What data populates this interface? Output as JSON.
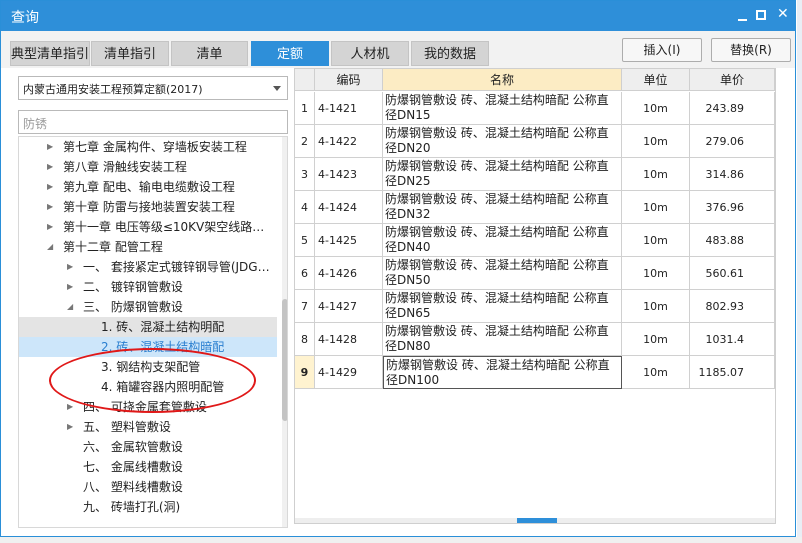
{
  "window": {
    "title": "查询"
  },
  "tabs": [
    "典型清单指引",
    "清单指引",
    "清单",
    "定额",
    "人材机",
    "我的数据"
  ],
  "active_tab": 3,
  "actions": {
    "insert": "插入(I)",
    "replace": "替换(R)"
  },
  "left": {
    "dropdown_value": "内蒙古通用安装工程预算定额(2017)",
    "search_value": "防锈",
    "tree": [
      {
        "label": "第七章 金属构件、穿墙板安装工程",
        "arrow": "▶"
      },
      {
        "label": "第八章 滑触线安装工程",
        "arrow": "▶"
      },
      {
        "label": "第九章 配电、输电电缆敷设工程",
        "arrow": "▶"
      },
      {
        "label": "第十章 防雷与接地装置安装工程",
        "arrow": "▶"
      },
      {
        "label": "第十一章 电压等级≤10KV架空线路…",
        "arrow": "▶"
      },
      {
        "label": "第十二章 配管工程",
        "arrow": "◢"
      },
      {
        "label": "一、 套接紧定式镀锌钢导管(JDG…",
        "arrow": "▶"
      },
      {
        "label": "二、 镀锌钢管敷设",
        "arrow": "▶"
      },
      {
        "label": "三、 防爆钢管敷设",
        "arrow": "◢"
      },
      {
        "label": "1. 砖、混凝土结构明配",
        "arrow": ""
      },
      {
        "label": "2. 砖、混凝土结构暗配",
        "arrow": ""
      },
      {
        "label": "3. 钢结构支架配管",
        "arrow": ""
      },
      {
        "label": "4. 箱罐容器内照明配管",
        "arrow": ""
      },
      {
        "label": "四、 可挠金属套管敷设",
        "arrow": "▶"
      },
      {
        "label": "五、 塑料管敷设",
        "arrow": "▶"
      },
      {
        "label": "六、 金属软管敷设",
        "arrow": ""
      },
      {
        "label": "七、 金属线槽敷设",
        "arrow": ""
      },
      {
        "label": "八、 塑料线槽敷设",
        "arrow": ""
      },
      {
        "label": "九、 砖墙打孔(洞)",
        "arrow": ""
      }
    ]
  },
  "grid": {
    "headers": [
      "编码",
      "名称",
      "单位",
      "单价"
    ],
    "rows": [
      {
        "idx": "1",
        "code": "4-1421",
        "name": "防爆钢管敷设 砖、混凝土结构暗配 公称直径DN15",
        "unit": "10m",
        "price": "243.89"
      },
      {
        "idx": "2",
        "code": "4-1422",
        "name": "防爆钢管敷设 砖、混凝土结构暗配 公称直径DN20",
        "unit": "10m",
        "price": "279.06"
      },
      {
        "idx": "3",
        "code": "4-1423",
        "name": "防爆钢管敷设 砖、混凝土结构暗配 公称直径DN25",
        "unit": "10m",
        "price": "314.86"
      },
      {
        "idx": "4",
        "code": "4-1424",
        "name": "防爆钢管敷设 砖、混凝土结构暗配 公称直径DN32",
        "unit": "10m",
        "price": "376.96"
      },
      {
        "idx": "5",
        "code": "4-1425",
        "name": "防爆钢管敷设 砖、混凝土结构暗配 公称直径DN40",
        "unit": "10m",
        "price": "483.88"
      },
      {
        "idx": "6",
        "code": "4-1426",
        "name": "防爆钢管敷设 砖、混凝土结构暗配 公称直径DN50",
        "unit": "10m",
        "price": "560.61"
      },
      {
        "idx": "7",
        "code": "4-1427",
        "name": "防爆钢管敷设 砖、混凝土结构暗配 公称直径DN65",
        "unit": "10m",
        "price": "802.93"
      },
      {
        "idx": "8",
        "code": "4-1428",
        "name": "防爆钢管敷设 砖、混凝土结构暗配 公称直径DN80",
        "unit": "10m",
        "price": "1031.4"
      },
      {
        "idx": "9",
        "code": "4-1429",
        "name": "防爆钢管敷设 砖、混凝土结构暗配 公称直径DN100",
        "unit": "10m",
        "price": "1185.07"
      }
    ]
  },
  "colors": {
    "accent": "#2e8fd9",
    "annotation": "#e01818",
    "header_highlight": "#fcecc4"
  }
}
